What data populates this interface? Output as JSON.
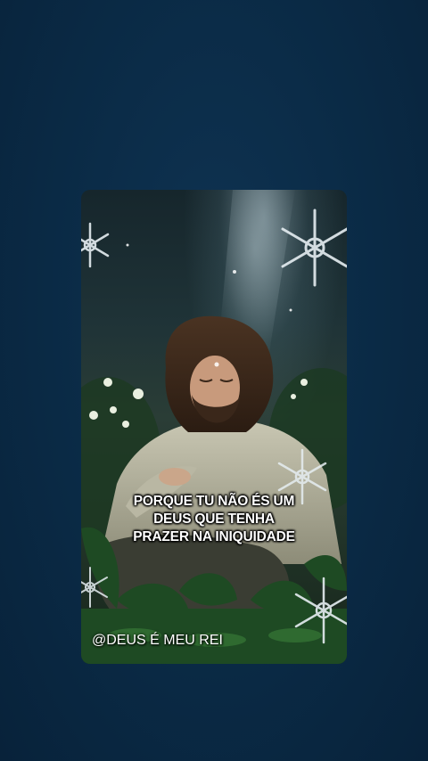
{
  "caption": {
    "line1": "PORQUE TU NÃO ÉS UM",
    "line2": "DEUS QUE TENHA",
    "line3": "PRAZER NA INIQUIDADE"
  },
  "watermark": "@DEUS É MEU REI",
  "colors": {
    "background": "#0b2b47",
    "caption_text": "#ffffff"
  },
  "decorations": [
    "snowflake-icon",
    "light-ray",
    "praying-figure",
    "night-garden-foliage"
  ]
}
